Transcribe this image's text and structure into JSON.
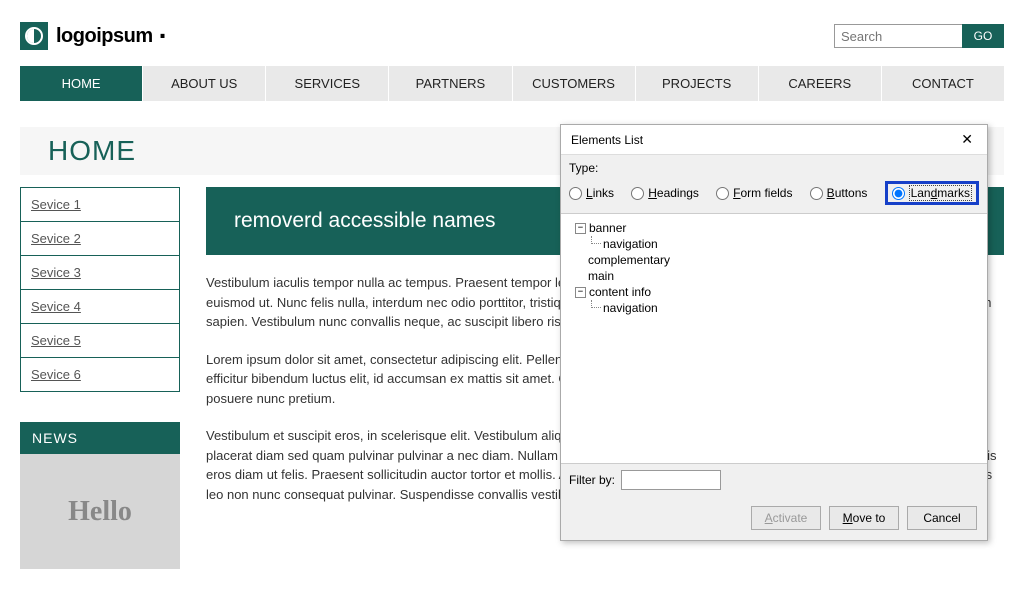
{
  "header": {
    "brand": "logoipsum",
    "search_placeholder": "Search",
    "go_label": "GO"
  },
  "nav": {
    "items": [
      "HOME",
      "ABOUT US",
      "SERVICES",
      "PARTNERS",
      "CUSTOMERS",
      "PROJECTS",
      "CAREERS",
      "CONTACT"
    ],
    "active_index": 0
  },
  "page": {
    "title": "HOME"
  },
  "sidebar": {
    "services": [
      "Sevice 1",
      "Sevice 2",
      "Sevice 3",
      "Sevice 4",
      "Sevice 5",
      "Sevice 6"
    ],
    "news_label": "NEWS",
    "placeholder_text": "Hello"
  },
  "main": {
    "section_title": "removerd accessible names",
    "p1": "Vestibulum iaculis tempor nulla ac tempus. Praesent tempor leo odio, urna condimentum, aliquet est sed, sodales justo. Pellentesque euismod ut. Nunc felis nulla, interdum nec odio porttitor, tristique tempus quam. Nulla eget libero vestibulum, malesuada leo nec, pretium sapien. Vestibulum nunc convallis neque, ac suscipit libero risus a tortor. Proin sagittis augue.",
    "p2": "Lorem ipsum dolor sit amet, consectetur adipiscing elit. Pellentesque enim, hendrerit vel arcu tincidunt, vulputate fringilla justo. Sed efficitur bibendum luctus elit, id accumsan ex mattis sit amet. Class aptent taciti per inceptos himenaeos. Nam porta enim tellus, ac posuere nunc pretium.",
    "p3": "Vestibulum et suscipit eros, in scelerisque elit. Vestibulum aliquet velit. Lorem ipsum dolor sit amet, consectetur adipiscing elit. Praesent placerat diam sed quam pulvinar pulvinar a nec diam. Nullam maximus, orci id ullamcorper aliquet, nulla augue rhoncus enim, at convallis eros diam ut felis. Praesent sollicitudin auctor tortor et mollis. Aliquam id nunc at nibh ornare porttitor. Aliquam a tempus risus. Sed mattis leo non nunc consequat pulvinar. Suspendisse convallis vestibulum ornare."
  },
  "dialog": {
    "title": "Elements List",
    "type_label": "Type:",
    "radios": {
      "links": "Links",
      "headings": "Headings",
      "formfields": "Form fields",
      "buttons": "Buttons",
      "landmarks": "Landmarks"
    },
    "tree": {
      "banner": "banner",
      "nav1": "navigation",
      "complementary": "complementary",
      "main": "main",
      "contentinfo": "content info",
      "nav2": "navigation"
    },
    "filter_label": "Filter by:",
    "buttons": {
      "activate": "Activate",
      "moveto": "Move to",
      "cancel": "Cancel"
    }
  }
}
